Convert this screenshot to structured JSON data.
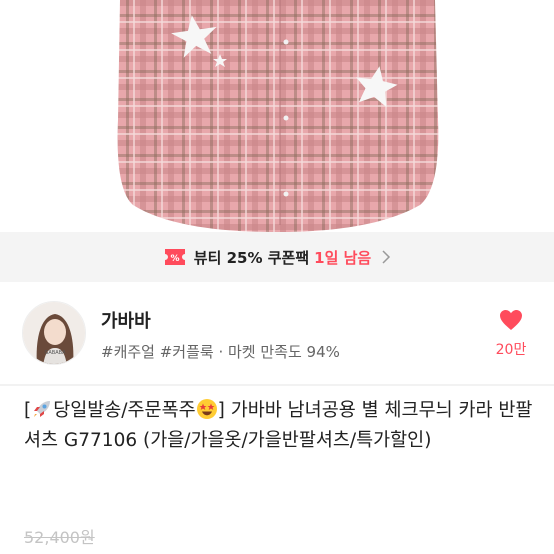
{
  "coupon": {
    "label": "뷰티 25% 쿠폰팩",
    "remaining": "1일 남음",
    "icon": "coupon-ticket-icon",
    "accent_color": "#ff4b5c"
  },
  "seller": {
    "name": "가바바",
    "tags": "#캐주얼 #커플룩 · 마켓 만족도 94%",
    "avatar_text": "GABABA",
    "like_count": "20만",
    "like_icon": "heart-icon"
  },
  "product": {
    "title_open": "[",
    "title_part1": "당일발송/주문폭주",
    "title_part2": "] 가바바 남녀공용 별 체크무늬 카라 반팔 셔츠 G77106 (가을/가을옷/가을반팔셔츠/특가할인)",
    "original_price": "52,400원"
  }
}
